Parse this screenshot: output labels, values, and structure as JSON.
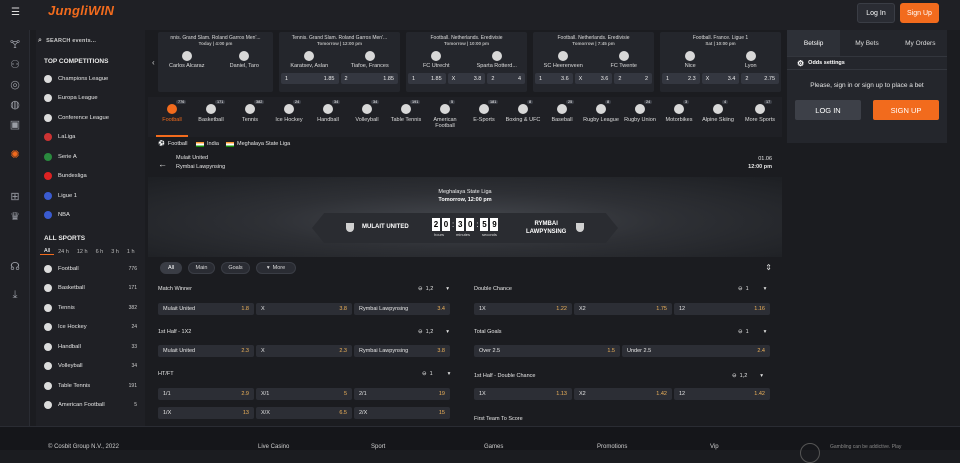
{
  "header": {
    "logo_a": "JungliWIN",
    "login_label": "Log In",
    "signup_label": "Sign Up"
  },
  "sidebar": {
    "search_placeholder": "SEARCH events...",
    "top_competitions_title": "TOP COMPETITIONS",
    "top_competitions": [
      {
        "label": "Champions League"
      },
      {
        "label": "Europa League"
      },
      {
        "label": "Conference League"
      },
      {
        "label": "LaLiga"
      },
      {
        "label": "Serie A"
      },
      {
        "label": "Bundesliga"
      },
      {
        "label": "Ligue 1"
      },
      {
        "label": "NBA"
      }
    ],
    "all_sports_title": "ALL SPORTS",
    "time_filters": [
      "All",
      "24 h",
      "12 h",
      "6 h",
      "3 h",
      "1 h"
    ],
    "all_sports": [
      {
        "label": "Football",
        "count": "776"
      },
      {
        "label": "Basketball",
        "count": "171"
      },
      {
        "label": "Tennis",
        "count": "382"
      },
      {
        "label": "Ice Hockey",
        "count": "24"
      },
      {
        "label": "Handball",
        "count": "33"
      },
      {
        "label": "Volleyball",
        "count": "34"
      },
      {
        "label": "Table Tennis",
        "count": "191"
      },
      {
        "label": "American Football",
        "count": "5"
      }
    ]
  },
  "ticker": [
    {
      "title": "nnis. Grand Slam. Roland Garros Men'...",
      "sub": "Today | 4:00 pm",
      "home": "Carlos Alcaraz",
      "away": "Daniel, Taro",
      "o1l": "",
      "o1v": "",
      "o2l": "",
      "o2v": ""
    },
    {
      "title": "Tennis. Grand Slam. Roland Garros Men'...",
      "sub": "Tomorrow | 12:00 pm",
      "home": "Karatsev, Aslan",
      "away": "Tiafoe, Frances",
      "o1l": "1",
      "o1v": "1.85",
      "o2l": "2",
      "o2v": "1.85"
    },
    {
      "title": "Football. Netherlands. Eredivisie",
      "sub": "Tomorrow | 10:00 pm",
      "home": "FC Utrecht",
      "away": "Sparta Rotterd...",
      "o1l": "1",
      "o1v": "1.85",
      "o2l": "X",
      "o2v": "3.8",
      "o3l": "2",
      "o3v": "4"
    },
    {
      "title": "Football. Netherlands. Eredivisie",
      "sub": "Tomorrow | 7:45 pm",
      "home": "SC Heerenveen",
      "away": "FC Twente",
      "o1l": "1",
      "o1v": "3.6",
      "o2l": "X",
      "o2v": "3.6",
      "o3l": "2",
      "o3v": "2"
    },
    {
      "title": "Football. France. Ligue 1",
      "sub": "Sat | 10:00 pm",
      "home": "Nice",
      "away": "Lyon",
      "o1l": "1",
      "o1v": "2.3",
      "o2l": "X",
      "o2v": "3.4",
      "o3l": "2",
      "o3v": "2.75"
    }
  ],
  "sports": [
    {
      "label": "Football",
      "count": "776"
    },
    {
      "label": "Basketball",
      "count": "171"
    },
    {
      "label": "Tennis",
      "count": "382"
    },
    {
      "label": "Ice Hockey",
      "count": "24"
    },
    {
      "label": "Handball",
      "count": "34"
    },
    {
      "label": "Volleyball",
      "count": "34"
    },
    {
      "label": "Table Tennis",
      "count": "191"
    },
    {
      "label": "American Football",
      "count": "5"
    },
    {
      "label": "E-Sports",
      "count": "181"
    },
    {
      "label": "Boxing & UFC",
      "count": "8"
    },
    {
      "label": "Baseball",
      "count": "25"
    },
    {
      "label": "Rugby League",
      "count": "8"
    },
    {
      "label": "Rugby Union",
      "count": "24"
    },
    {
      "label": "Motorbikes",
      "count": "3"
    },
    {
      "label": "Alpine Skiing",
      "count": "4"
    },
    {
      "label": "More Sports",
      "count": "17"
    }
  ],
  "crumbs": {
    "sport": "Football",
    "country": "India",
    "league": "Meghalaya State Liga",
    "home": "Mulait United",
    "away": "Rymbai Lawpynsing",
    "date": "01.06",
    "time": "12:00 pm"
  },
  "banner": {
    "league": "Meghalaya State Liga",
    "date": "Tomorrow, 12:00 pm",
    "home": "MULAIT UNITED",
    "away_1": "RYMBAI",
    "away_2": "LAWPYNSING",
    "d1": "2",
    "d2": "0",
    "d3": "3",
    "d4": "0",
    "d5": "5",
    "d6": "9",
    "hours": "hours",
    "minutes": "minutes",
    "seconds": "seconds"
  },
  "filters": {
    "all": "All",
    "main": "Main",
    "goals": "Goals",
    "more": "More"
  },
  "markets": {
    "match_winner": {
      "title": "Match Winner",
      "ctrl": "1,2",
      "c1l": "Mulait United",
      "c1v": "1.8",
      "c2l": "X",
      "c2v": "3.8",
      "c3l": "Rymbai Lawpynsing",
      "c3v": "3.4"
    },
    "double_chance": {
      "title": "Double Chance",
      "ctrl": "1",
      "c1l": "1X",
      "c1v": "1.22",
      "c2l": "X2",
      "c2v": "1.75",
      "c3l": "12",
      "c3v": "1.16"
    },
    "first_half": {
      "title": "1st Half - 1X2",
      "ctrl": "1,2",
      "c1l": "Mulait United",
      "c1v": "2.3",
      "c2l": "X",
      "c2v": "2.3",
      "c3l": "Rymbai Lawpynsing",
      "c3v": "3.8"
    },
    "total_goals": {
      "title": "Total Goals",
      "ctrl": "1",
      "c1l": "Over 2.5",
      "c1v": "1.5",
      "c2l": "Under 2.5",
      "c2v": "2.4"
    },
    "htft": {
      "title": "HT/FT",
      "ctrl": "1",
      "r1": [
        [
          "1/1",
          "2.9"
        ],
        [
          "X/1",
          "5"
        ],
        [
          "2/1",
          "19"
        ]
      ],
      "r2": [
        [
          "1/X",
          "13"
        ],
        [
          "X/X",
          "6.5"
        ],
        [
          "2/X",
          "15"
        ]
      ]
    },
    "first_half_dc": {
      "title": "1st Half - Double Chance",
      "ctrl": "1,2",
      "c1l": "1X",
      "c1v": "1.13",
      "c2l": "X2",
      "c2v": "1.42",
      "c3l": "12",
      "c3v": "1.42"
    },
    "first_team": {
      "title": "First Team To Score"
    }
  },
  "betslip": {
    "tab1": "Betslip",
    "tab2": "My Bets",
    "tab3": "My Orders",
    "odds_settings": "Odds settings",
    "message": "Please, sign in or sign up to place a bet",
    "login": "LOG IN",
    "signup": "SIGN UP"
  },
  "footer": {
    "copyright": "© Cosbit Group N.V., 2022",
    "live": "Live Casino",
    "sport": "Sport",
    "games": "Games",
    "promotions": "Promotions",
    "vip": "Vip",
    "gambling": "Gambling can be addictive. Play"
  }
}
